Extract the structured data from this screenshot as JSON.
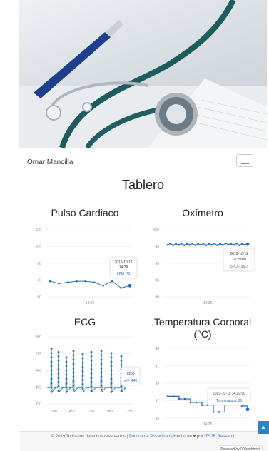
{
  "colors": {
    "accent": "#2a6ebb",
    "link": "#3a7bd5",
    "scroll_button": "#2a85c9"
  },
  "navbar": {
    "brand": "Omar Mancilla",
    "menu_icon": "hamburger-icon"
  },
  "page": {
    "title": "Tablero"
  },
  "charts": {
    "pulse": {
      "title": "Pulso Cardiaco",
      "tooltip": {
        "date": "2019-10-11",
        "time": "14:29",
        "value_label": "LPM: 70"
      }
    },
    "oximeter": {
      "title": "Oxímetro",
      "tooltip": {
        "date": "2019-10-11",
        "time": "14:29:00",
        "value_label": "SPO₂: 95.7"
      }
    },
    "ecg": {
      "title": "ECG",
      "tooltip": {
        "x_label": "1250",
        "value_label": "mV: 446"
      }
    },
    "temperature": {
      "title": "Temperatura Corporal (°C)",
      "tooltip": {
        "datetime": "2019-10-11 14:29:00",
        "value_label": "Temperatura: 36"
      }
    }
  },
  "chart_data": [
    {
      "type": "line",
      "title": "Pulso Cardiaco",
      "y_ticks": [
        "120",
        "105",
        "90",
        "75",
        "60"
      ],
      "ylim": [
        60,
        120
      ],
      "x_tick_labels": [
        "14:25"
      ],
      "values": [
        74,
        72,
        73,
        74,
        74,
        73,
        70,
        74,
        68,
        70
      ],
      "grid": true
    },
    {
      "type": "line",
      "title": "Oxímetro",
      "y_ticks": [
        "100",
        "95",
        "90",
        "85",
        "80"
      ],
      "ylim": [
        80,
        100
      ],
      "x_tick_labels": [
        "14:25"
      ],
      "values": [
        95.5,
        95.9,
        95.4,
        95.8,
        95.5,
        95.9,
        95.4,
        95.8,
        95.5,
        95.9,
        95.4,
        95.8,
        95.5,
        95.9,
        95.4,
        95.8,
        95.5,
        95.9,
        95.4,
        95.8,
        95.5,
        95.9,
        95.6,
        95.8,
        95.5,
        95.9,
        95.4,
        95.8,
        95.5,
        95.7
      ],
      "grid": true
    },
    {
      "type": "line",
      "title": "ECG",
      "y_ticks": [
        "950",
        "795",
        "640",
        "485",
        "330"
      ],
      "ylim": [
        330,
        950
      ],
      "x_tick_labels": [
        "200",
        "450",
        "720",
        "980",
        "1250"
      ],
      "xlim": [
        100,
        1300
      ],
      "spikes": [
        {
          "x": 160,
          "peak": 840
        },
        {
          "x": 260,
          "peak": 810
        },
        {
          "x": 370,
          "peak": 760
        },
        {
          "x": 470,
          "peak": 820
        },
        {
          "x": 600,
          "peak": 790
        },
        {
          "x": 720,
          "peak": 810
        },
        {
          "x": 860,
          "peak": 820
        },
        {
          "x": 1000,
          "peak": 800
        },
        {
          "x": 1140,
          "peak": 770
        }
      ],
      "baseline": 480,
      "trough": 440,
      "grid": true
    },
    {
      "type": "line",
      "title": "Temperatura Corporal (°C)",
      "y_ticks": [
        "43",
        "41",
        "39",
        "37",
        "35"
      ],
      "ylim": [
        35,
        43
      ],
      "x_tick_labels": [
        "14:25"
      ],
      "values": [
        37.5,
        37.5,
        37.2,
        37.2,
        36.8,
        36.8,
        36.5,
        36.5,
        35.7,
        35.7,
        36.6,
        36.6,
        36.6,
        36.4,
        36.0
      ],
      "grid": true
    }
  ],
  "footer": {
    "copyright": "© 2019 Todos los derechos reservados |",
    "privacy_link": "Política de Privacidad",
    "made_by": "| Hecho de ♥ por",
    "org_link": "ITSJR Research",
    "powered": "Powered by 000webhost",
    "scroll_top_icon": "arrow-up-icon"
  }
}
